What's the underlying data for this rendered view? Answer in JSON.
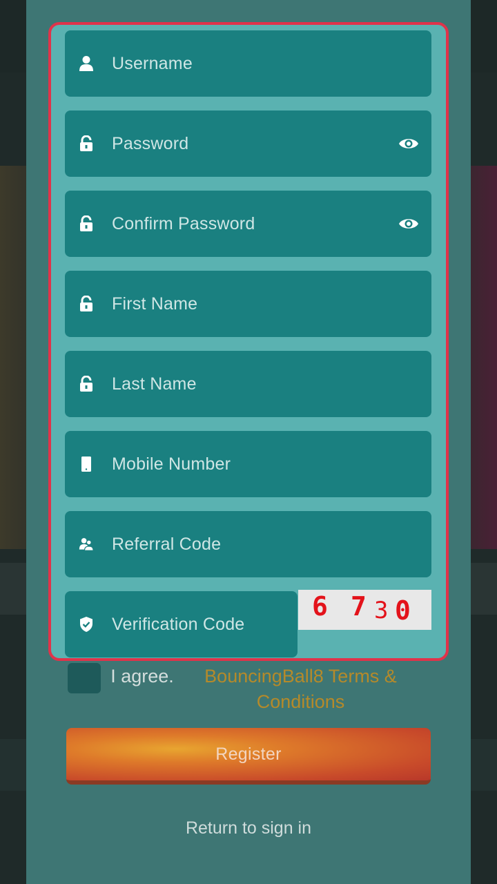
{
  "form": {
    "fields": [
      {
        "label": "Username",
        "icon": "user-icon"
      },
      {
        "label": "Password",
        "icon": "lock-icon",
        "toggle": "eye-icon"
      },
      {
        "label": "Confirm Password",
        "icon": "lock-icon",
        "toggle": "eye-icon"
      },
      {
        "label": "First Name",
        "icon": "lock-icon"
      },
      {
        "label": "Last Name",
        "icon": "lock-icon"
      },
      {
        "label": "Mobile Number",
        "icon": "phone-icon"
      },
      {
        "label": "Referral Code",
        "icon": "users-icon"
      },
      {
        "label": "Verification Code",
        "icon": "shield-check-icon"
      }
    ],
    "captcha": {
      "digits": [
        "6",
        "7",
        "3",
        "0"
      ]
    }
  },
  "agreement": {
    "agree_text": "I agree.",
    "terms_link": "BouncingBall8 Terms & Conditions"
  },
  "actions": {
    "register_label": "Register",
    "return_label": "Return to sign in"
  },
  "colors": {
    "field_bg": "#1a8080",
    "card_bg": "#5ab2b1",
    "highlight_border": "#e0334a",
    "terms_link": "#b58a2a"
  }
}
